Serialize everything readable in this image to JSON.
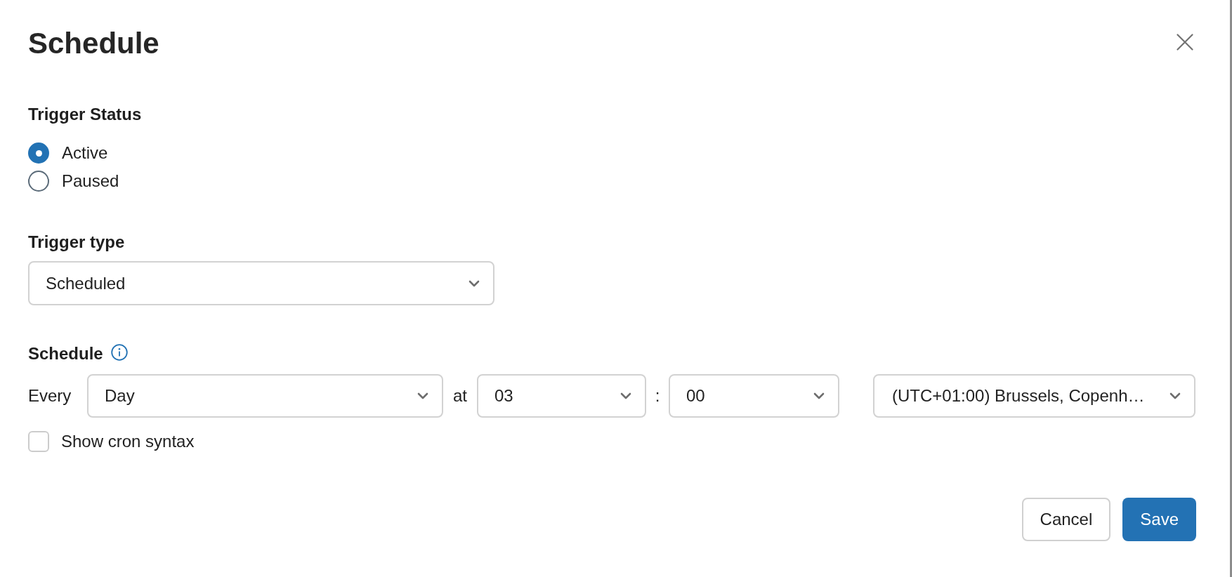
{
  "dialog": {
    "title": "Schedule"
  },
  "trigger_status": {
    "label": "Trigger Status",
    "options": [
      {
        "label": "Active",
        "selected": true
      },
      {
        "label": "Paused",
        "selected": false
      }
    ]
  },
  "trigger_type": {
    "label": "Trigger type",
    "value": "Scheduled"
  },
  "schedule": {
    "label": "Schedule",
    "every_label": "Every",
    "interval": {
      "value": "Day"
    },
    "at_label": "at",
    "hour": {
      "value": "03"
    },
    "separator": ":",
    "minute": {
      "value": "00"
    },
    "timezone": {
      "value": "(UTC+01:00) Brussels, Copenh…"
    }
  },
  "show_cron_syntax": {
    "label": "Show cron syntax",
    "checked": false
  },
  "buttons": [
    {
      "label": "Cancel",
      "kind": "secondary"
    },
    {
      "label": "Save",
      "kind": "primary"
    }
  ]
}
